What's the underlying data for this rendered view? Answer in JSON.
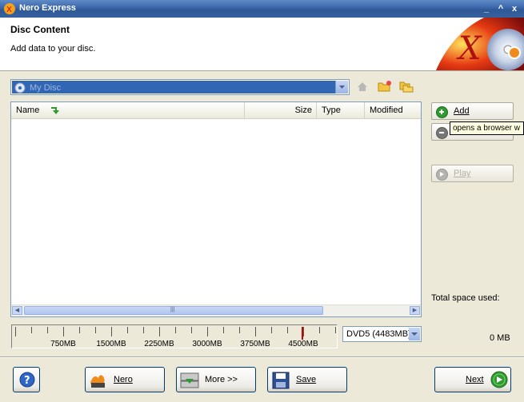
{
  "window": {
    "title": "Nero Express"
  },
  "header": {
    "title": "Disc Content",
    "subtitle": "Add data to your disc."
  },
  "disc": {
    "name": "My Disc"
  },
  "list": {
    "columns": [
      "Name",
      "Size",
      "Type",
      "Modified"
    ],
    "rows": []
  },
  "side": {
    "add_label": "Add",
    "delete_label": "",
    "play_label": "Play",
    "tooltip": "opens a browser w",
    "total_label": "Total space used:",
    "total_value": "0 MB"
  },
  "ruler": {
    "ticks": [
      "750MB",
      "1500MB",
      "2250MB",
      "3000MB",
      "3750MB",
      "4500MB"
    ],
    "marker_mb": 4483
  },
  "disc_type": {
    "selected": "DVD5 (4483MB)"
  },
  "footer": {
    "nero_label": "Nero",
    "more_label": "More >>",
    "save_label": "Save",
    "next_label": "Next"
  },
  "colors": {
    "titlebar": "#3a65a8",
    "accent_green": "#2f9b2f",
    "tooltip_bg": "#ffffe1"
  }
}
